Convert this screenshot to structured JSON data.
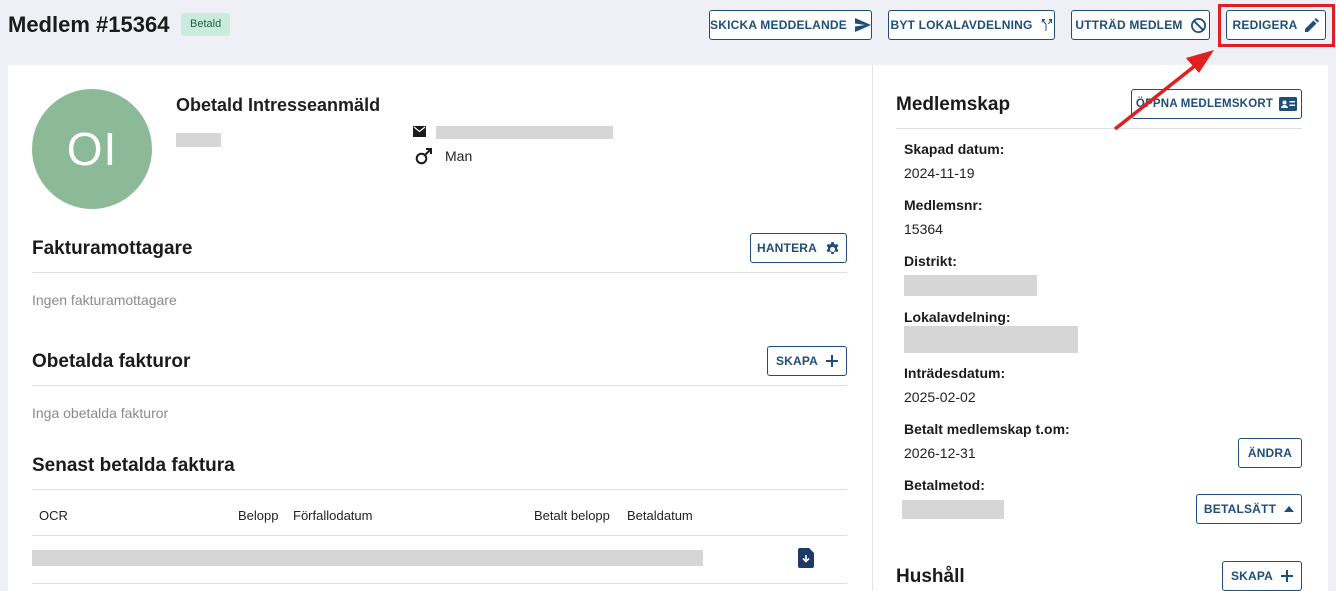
{
  "header": {
    "title": "Medlem #15364",
    "status_badge": "Betald",
    "actions": {
      "send_message": "SKICKA MEDDELANDE",
      "change_branch": "BYT LOKALAVDELNING",
      "resign": "UTTRÄD MEDLEM",
      "edit": "REDIGERA"
    }
  },
  "profile": {
    "initials": "OI",
    "name": "Obetald Intresseanmäld",
    "gender": "Man",
    "avatar_color": "#8cba98"
  },
  "invoice_recipients": {
    "title": "Fakturamottagare",
    "manage_label": "HANTERA",
    "empty_text": "Ingen fakturamottagare"
  },
  "unpaid_invoices": {
    "title": "Obetalda fakturor",
    "create_label": "SKAPA",
    "empty_text": "Inga obetalda fakturor"
  },
  "last_paid": {
    "title": "Senast betalda faktura",
    "columns": [
      "OCR",
      "Belopp",
      "Förfallodatum",
      "Betalt belopp",
      "Betaldatum"
    ]
  },
  "membership": {
    "title": "Medlemskap",
    "open_card_label": "ÖPPNA MEDLEMSKORT",
    "fields": {
      "created_label": "Skapad datum:",
      "created_value": "2024-11-19",
      "member_no_label": "Medlemsnr:",
      "member_no_value": "15364",
      "district_label": "Distrikt:",
      "branch_label": "Lokalavdelning:",
      "joined_label": "Inträdesdatum:",
      "joined_value": "2025-02-02",
      "paid_until_label": "Betalt medlemskap t.om:",
      "paid_until_value": "2026-12-31",
      "payment_method_label": "Betalmetod:"
    },
    "change_label": "ÄNDRA",
    "payment_method_button": "BETALSÄTT"
  },
  "household": {
    "title": "Hushåll",
    "create_label": "SKAPA"
  },
  "colors": {
    "accent": "#1f4e79",
    "highlight": "#e02020",
    "badge_bg": "#c9ecdd"
  }
}
